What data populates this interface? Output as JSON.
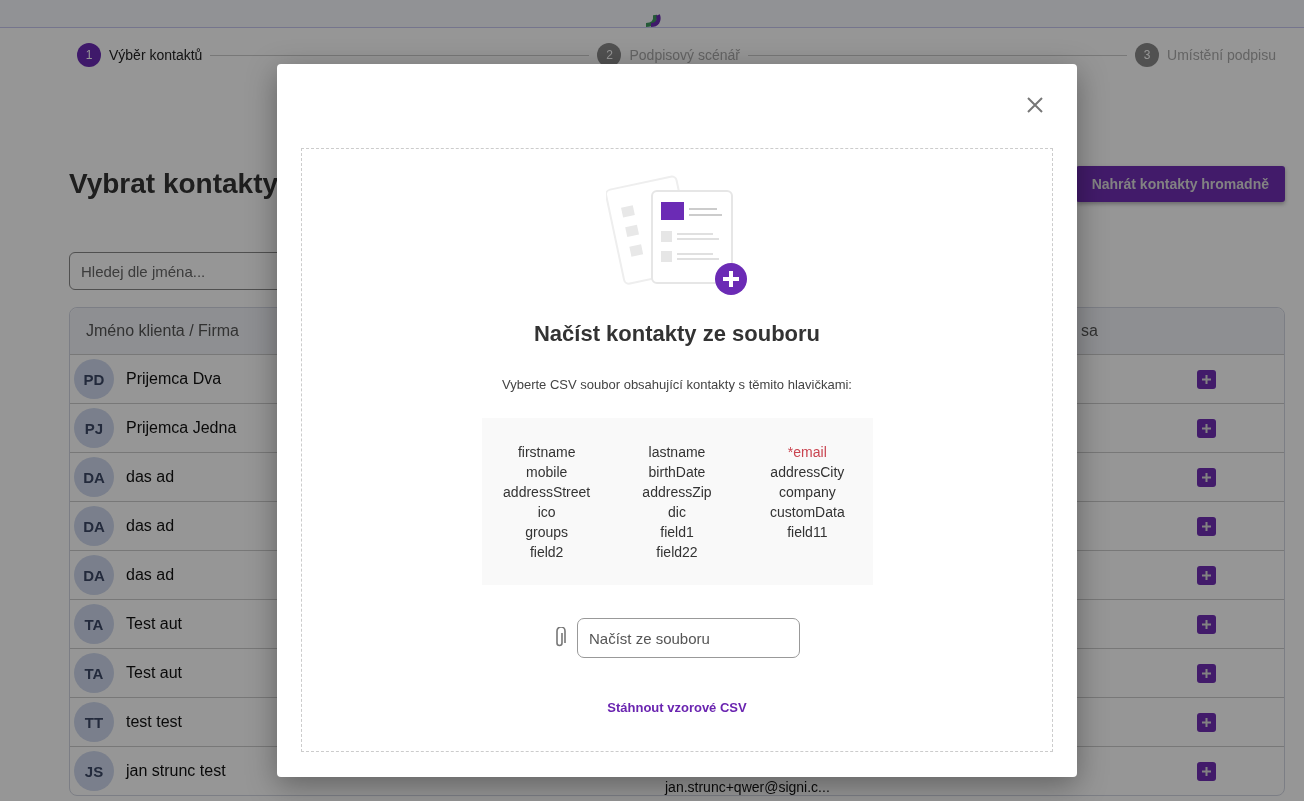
{
  "steps": [
    {
      "number": "1",
      "label": "Výběr kontaktů",
      "selected": true
    },
    {
      "number": "2",
      "label": "Podpisový scénář",
      "selected": false
    },
    {
      "number": "3",
      "label": "Umístění podpisu",
      "selected": false
    }
  ],
  "page": {
    "title": "Vybrat kontakty",
    "bulk_button": "Nahrát kontakty hromadně",
    "search": {
      "placeholder": "Hledej dle jména..."
    }
  },
  "table": {
    "columns": [
      "Jméno klienta / Firma",
      "sa"
    ],
    "rows": [
      {
        "initials": "PD",
        "name": "Prijemca Dva"
      },
      {
        "initials": "PJ",
        "name": "Prijemca Jedna"
      },
      {
        "initials": "DA",
        "name": "das ad"
      },
      {
        "initials": "DA",
        "name": "das ad"
      },
      {
        "initials": "DA",
        "name": "das ad"
      },
      {
        "initials": "TA",
        "name": "Test aut"
      },
      {
        "initials": "TA",
        "name": "Test aut"
      },
      {
        "initials": "TT",
        "name": "test test"
      },
      {
        "initials": "JS",
        "name": "jan strunc test",
        "email": "jan.strunc+qwer@signi.c..."
      }
    ]
  },
  "dialog": {
    "title": "Načíst kontakty ze souboru",
    "instruction": "Vyberte CSV soubor obsahující kontakty s těmito hlavičkami:",
    "header_columns": [
      [
        {
          "name": "firstname",
          "required": false
        },
        {
          "name": "mobile",
          "required": false
        },
        {
          "name": "addressStreet",
          "required": false
        },
        {
          "name": "ico",
          "required": false
        },
        {
          "name": "groups",
          "required": false
        },
        {
          "name": "field2",
          "required": false
        }
      ],
      [
        {
          "name": "lastname",
          "required": false
        },
        {
          "name": "birthDate",
          "required": false
        },
        {
          "name": "addressZip",
          "required": false
        },
        {
          "name": "dic",
          "required": false
        },
        {
          "name": "field1",
          "required": false
        },
        {
          "name": "field22",
          "required": false
        }
      ],
      [
        {
          "name": "*email",
          "required": true
        },
        {
          "name": "addressCity",
          "required": false
        },
        {
          "name": "company",
          "required": false
        },
        {
          "name": "customData",
          "required": false
        },
        {
          "name": "field11",
          "required": false
        }
      ]
    ],
    "file_field": {
      "placeholder": "Načíst ze souboru"
    },
    "download_link": "Stáhnout vzorové CSV"
  }
}
